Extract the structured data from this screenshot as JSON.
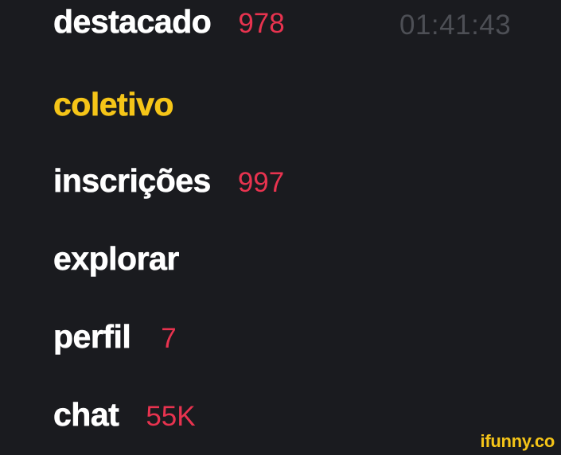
{
  "menu": {
    "items": [
      {
        "label": "destacado",
        "badge": "978"
      },
      {
        "label": "coletivo",
        "badge": ""
      },
      {
        "label": "inscrições",
        "badge": "997"
      },
      {
        "label": "explorar",
        "badge": ""
      },
      {
        "label": "perfil",
        "badge": "7"
      },
      {
        "label": "chat",
        "badge": "55K"
      }
    ],
    "active_item": "coletivo"
  },
  "clock": "01:41:43",
  "watermark": "ifunny.co",
  "colors": {
    "background": "#1a1b1f",
    "label": "#ffffff",
    "active_label": "#f5c518",
    "badge": "#e8334f",
    "clock": "#4d4f55",
    "watermark": "#f5c518"
  }
}
